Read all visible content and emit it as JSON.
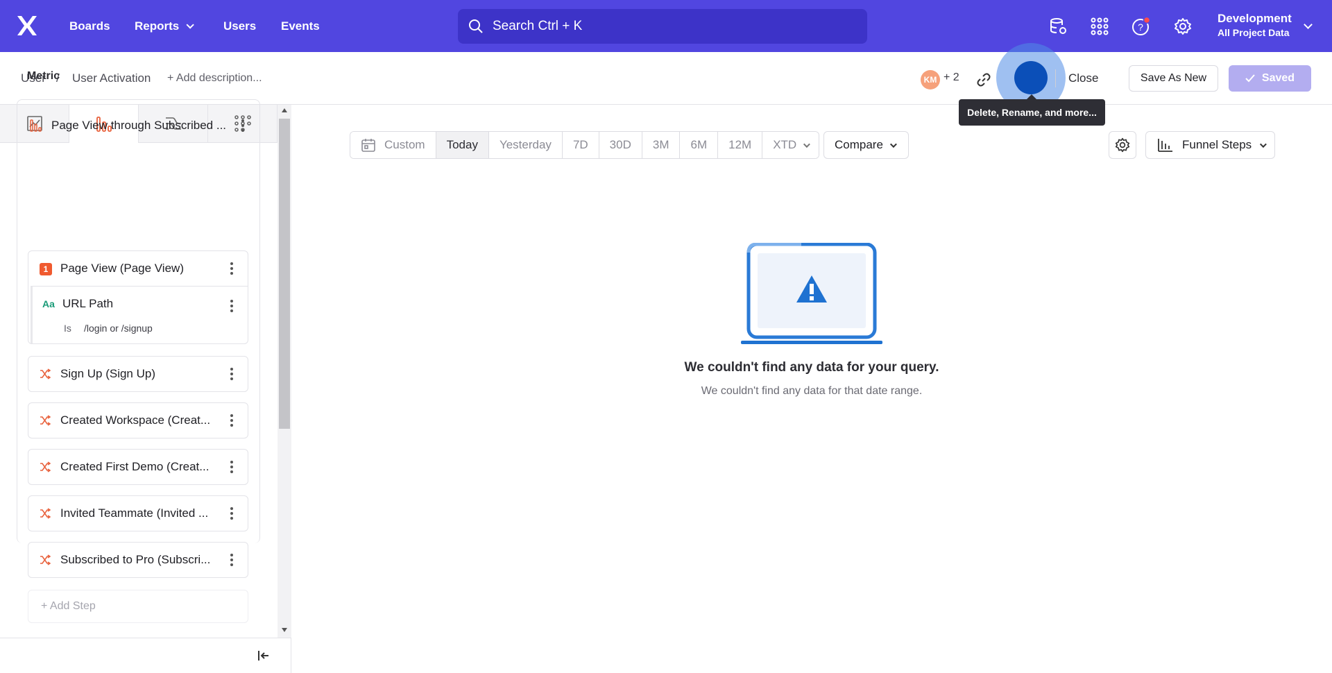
{
  "nav": {
    "items": [
      "Boards",
      "Reports",
      "Users",
      "Events"
    ],
    "search_placeholder": "Search  Ctrl + K",
    "env_name": "Development",
    "env_sub": "All Project Data",
    "brand_color": "#5146e0"
  },
  "header": {
    "breadcrumb_root": "User",
    "breadcrumb_sep": "/",
    "report_title": "User Activation",
    "add_description": "+ Add description...",
    "avatar_initials": "KM",
    "avatar_more": "+ 2",
    "close_label": "Close",
    "save_as_new_label": "Save As New",
    "saved_label": "Saved",
    "tooltip": "Delete, Rename, and more..."
  },
  "sidebar": {
    "metric_label": "Metric",
    "metric_name": "Page View through Subscribed ...",
    "steps": [
      {
        "badge": "1",
        "label": "Page View (Page View)"
      },
      {
        "label": "Sign Up (Sign Up)"
      },
      {
        "label": "Created Workspace (Creat..."
      },
      {
        "label": "Created First Demo (Creat..."
      },
      {
        "label": "Invited Teammate (Invited ..."
      },
      {
        "label": "Subscribed to Pro (Subscri..."
      }
    ],
    "filter": {
      "type_badge": "Aa",
      "name": "URL Path",
      "operator": "Is",
      "value": "/login or /signup"
    },
    "add_step": "+  Add Step"
  },
  "main": {
    "date_ranges": [
      "Custom",
      "Today",
      "Yesterday",
      "7D",
      "30D",
      "3M",
      "6M",
      "12M",
      "XTD"
    ],
    "active_range": "Today",
    "compare_label": "Compare",
    "chart_type_label": "Funnel Steps",
    "empty_title": "We couldn't find any data for your query.",
    "empty_subtitle": "We couldn't find any data for that date range."
  }
}
